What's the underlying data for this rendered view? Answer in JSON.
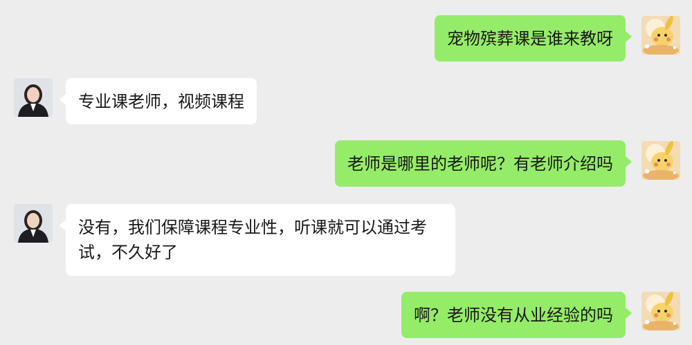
{
  "colors": {
    "background": "#ededed",
    "outgoing_bubble": "#95ec69",
    "incoming_bubble": "#ffffff",
    "text": "#181818"
  },
  "messages": [
    {
      "direction": "outgoing",
      "text": "宠物殡葬课是谁来教呀",
      "avatar": "user-avatar"
    },
    {
      "direction": "incoming",
      "text": "专业课老师，视频课程",
      "avatar": "agent-avatar"
    },
    {
      "direction": "outgoing",
      "text": "老师是哪里的老师呢？有老师介绍吗",
      "avatar": "user-avatar"
    },
    {
      "direction": "incoming",
      "text": "没有，我们保障课程专业性，听课就可以通过考试，不久好了",
      "avatar": "agent-avatar"
    },
    {
      "direction": "outgoing",
      "text": "啊？老师没有从业经验的吗",
      "avatar": "user-avatar"
    }
  ]
}
